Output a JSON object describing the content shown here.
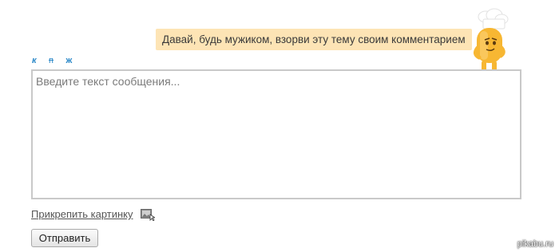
{
  "tooltip": {
    "text": "Давай, будь мужиком, взорви эту тему своим комментарием"
  },
  "mascot": {
    "icon": "chef-mascot-icon",
    "color": "#f7b733"
  },
  "format_bar": {
    "italic_label": "к",
    "strike_label": "п",
    "bold_label": "ж",
    "color": "#2b88c8"
  },
  "editor": {
    "value": "",
    "placeholder": "Введите текст сообщения..."
  },
  "attach": {
    "label": "Прикрепить картинку",
    "icon": "image-attach-icon"
  },
  "submit": {
    "label": "Отправить"
  },
  "watermark": {
    "text": "pikabu.ru"
  }
}
